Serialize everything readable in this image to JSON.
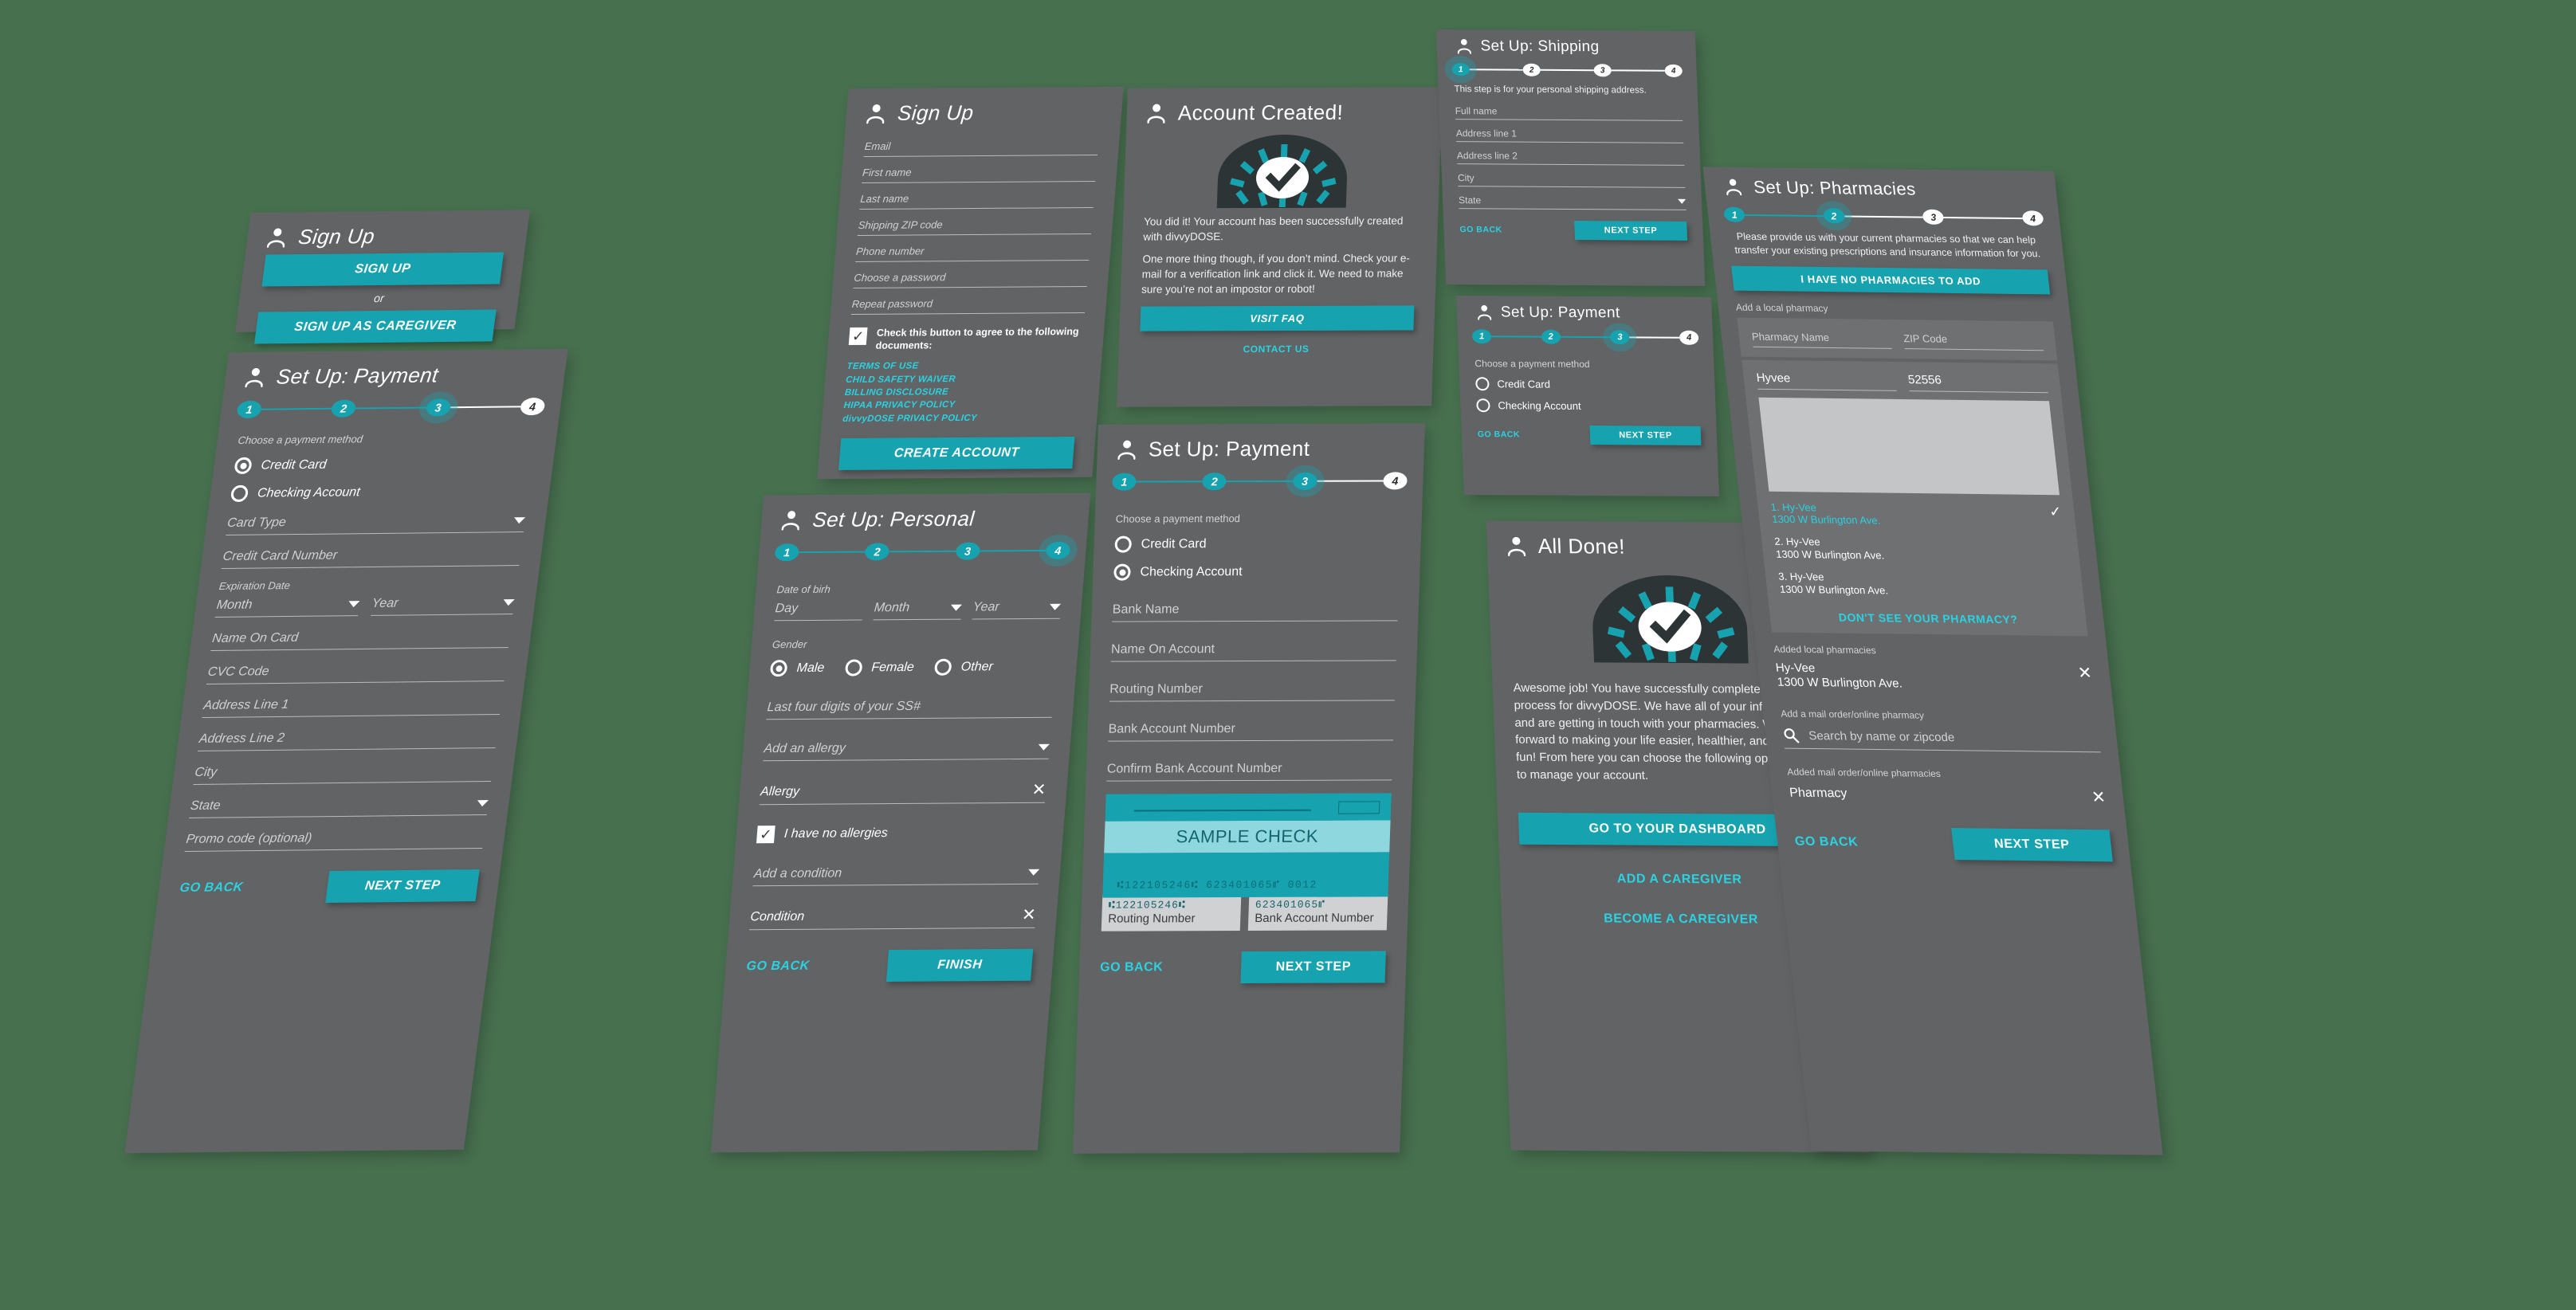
{
  "theme": {
    "background": "#47704f",
    "card_bg": "#616365",
    "accent": "#17a2b0",
    "link": "#2ad2e2",
    "panel_bg": "#6e7072",
    "map_bg": "#c3c5c6"
  },
  "signup": {
    "title": "Sign Up",
    "sign_up_button": "SIGN UP",
    "or": "or",
    "caregiver_button": "SIGN UP AS CAREGIVER"
  },
  "signup_form": {
    "title": "Sign Up",
    "fields": [
      "Email",
      "First name",
      "Last name",
      "Shipping ZIP code",
      "Phone number",
      "Choose a password",
      "Repeat password"
    ],
    "agree_text": "Check this button to agree to the following documents:",
    "documents": [
      "TERMS OF USE",
      "CHILD SAFETY WAIVER",
      "BILLING DISCLOSURE",
      "HIPAA PRIVACY POLICY",
      "divvyDOSE PRIVACY POLICY"
    ],
    "create_button": "CREATE ACCOUNT"
  },
  "payment_cc": {
    "title": "Set Up: Payment",
    "steps": [
      "1",
      "2",
      "3",
      "4"
    ],
    "active_step": 3,
    "method_label": "Choose a payment method",
    "options": [
      "Credit Card",
      "Checking Account"
    ],
    "selected_option": "Credit Card",
    "fields": [
      "Card Type",
      "Credit Card Number",
      "Expiration Date",
      "Month",
      "Year",
      "Name On Card",
      "CVC Code",
      "Address Line 1",
      "Address Line 2",
      "City",
      "State",
      "Promo code (optional)"
    ],
    "go_back": "GO BACK",
    "next_step": "NEXT STEP"
  },
  "personal": {
    "title": "Set Up: Personal",
    "steps": [
      "1",
      "2",
      "3",
      "4"
    ],
    "active_step": 4,
    "dob_label": "Date of birh",
    "dob_fields": [
      "Day",
      "Month",
      "Year"
    ],
    "gender_label": "Gender",
    "genders": [
      "Male",
      "Female",
      "Other"
    ],
    "selected_gender": "Male",
    "ssn_field": "Last four digits of your SS#",
    "allergy_select": "Add an allergy",
    "allergy_value": "Allergy",
    "no_allergies": "I have no allergies",
    "condition_select": "Add a condition",
    "condition_value": "Condition",
    "go_back": "GO BACK",
    "finish": "FINISH"
  },
  "account_created": {
    "title": "Account Created!",
    "paragraph1": "You did it! Your account has been successfully created with divvyDOSE.",
    "paragraph2": "One more thing though, if you don’t mind. Check your e-mail for a verification link and click it. We need to make sure you’re not an impostor or robot!",
    "faq_button": "VISIT FAQ",
    "contact_link": "CONTACT US"
  },
  "payment_check": {
    "title": "Set Up: Payment",
    "steps": [
      "1",
      "2",
      "3",
      "4"
    ],
    "active_step": 3,
    "method_label": "Choose a payment method",
    "options": [
      "Credit Card",
      "Checking Account"
    ],
    "selected_option": "Checking Account",
    "fields": [
      "Bank Name",
      "Name On Account",
      "Routing Number",
      "Bank Account Number",
      "Confirm Bank Account Number"
    ],
    "check": {
      "title": "SAMPLE CHECK",
      "micr": "⑆122105246⑆ 623401065⑈ 0012",
      "routing_number": "⑆122105246⑆",
      "routing_caption": "Routing Number",
      "account_number": "623401065⑈",
      "account_caption": "Bank Account Number"
    },
    "go_back": "GO BACK",
    "next_step": "NEXT STEP"
  },
  "shipping": {
    "title": "Set Up: Shipping",
    "steps": [
      "1",
      "2",
      "3",
      "4"
    ],
    "active_step": 1,
    "description": "This step is for your personal shipping address.",
    "fields": [
      "Full name",
      "Address line 1",
      "Address line 2",
      "City",
      "State"
    ],
    "go_back": "GO BACK",
    "next_step": "NEXT STEP"
  },
  "payment_empty": {
    "title": "Set Up: Payment",
    "steps": [
      "1",
      "2",
      "3",
      "4"
    ],
    "active_step": 3,
    "method_label": "Choose a payment method",
    "options": [
      "Credit Card",
      "Checking Account"
    ],
    "selected_option": "",
    "go_back": "GO BACK",
    "next_step": "NEXT STEP"
  },
  "all_done": {
    "title": "All Done!",
    "paragraph": "Awesome job! You have successfully completed the sign-up process for divvyDOSE. We have all of your information and are getting in touch with your pharmacies. We look forward to making your life easier, healthier, and just more fun! From here you can choose the following options below to manage your account.",
    "dashboard_button": "GO TO YOUR DASHBOARD",
    "add_caregiver_link": "ADD A CAREGIVER",
    "become_caregiver_link": "BECOME A CAREGIVER"
  },
  "pharmacies": {
    "title": "Set Up: Pharmacies",
    "steps": [
      "1",
      "2",
      "3",
      "4"
    ],
    "active_step": 2,
    "description": "Please provide us with your current pharmacies so that we can help transfer your existing prescriptions and insurance information for you.",
    "no_pharmacies_button": "I HAVE NO PHARMACIES TO ADD",
    "add_local_label": "Add a local pharmacy",
    "name_placeholder": "Pharmacy Name",
    "zip_placeholder": "ZIP Code",
    "name_value": "Hyvee",
    "zip_value": "52556",
    "results": [
      {
        "label": "1. Hy-Vee",
        "address": "1300 W Burlington Ave.",
        "selected": true
      },
      {
        "label": "2. Hy-Vee",
        "address": "1300 W Burlington Ave.",
        "selected": false
      },
      {
        "label": "3. Hy-Vee",
        "address": "1300 W Burlington Ave.",
        "selected": false
      }
    ],
    "dont_see_link": "DON'T SEE YOUR PHARMACY?",
    "added_local_label": "Added local pharmacies",
    "added_local": {
      "name": "Hy-Vee",
      "address": "1300 W Burlington Ave."
    },
    "add_mail_label": "Add a mail order/online pharmacy",
    "search_placeholder": "Search by name or zipcode",
    "added_mail_label": "Added mail order/online pharmacies",
    "added_mail": "Pharmacy",
    "go_back": "GO BACK",
    "next_step": "NEXT STEP"
  }
}
